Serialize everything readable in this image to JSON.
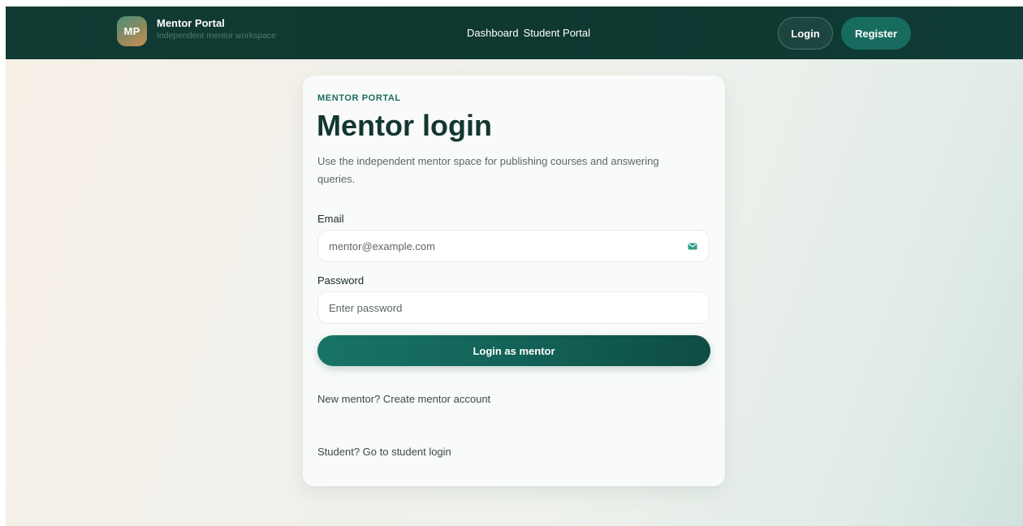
{
  "header": {
    "avatar_initials": "MP",
    "brand_title": "Mentor Portal",
    "brand_subtitle": "Independent mentor workspace",
    "nav": [
      {
        "label": "Dashboard"
      },
      {
        "label": "Student Portal"
      }
    ],
    "login_label": "Login",
    "register_label": "Register"
  },
  "card": {
    "eyebrow": "MENTOR PORTAL",
    "title": "Mentor login",
    "description": "Use the independent mentor space for publishing courses and answering queries.",
    "email_label": "Email",
    "email_placeholder": "mentor@example.com",
    "password_label": "Password",
    "password_placeholder": "Enter password",
    "submit_label": "Login as mentor",
    "create_account_link": "New mentor? Create mentor account",
    "student_login_link": "Student? Go to student login"
  },
  "colors": {
    "header_bg": "#0e3830",
    "accent": "#176c5f",
    "title_text": "#143630",
    "mail_icon": "#2a9d84"
  },
  "icons": {
    "email_field_icon": "mail-icon"
  }
}
